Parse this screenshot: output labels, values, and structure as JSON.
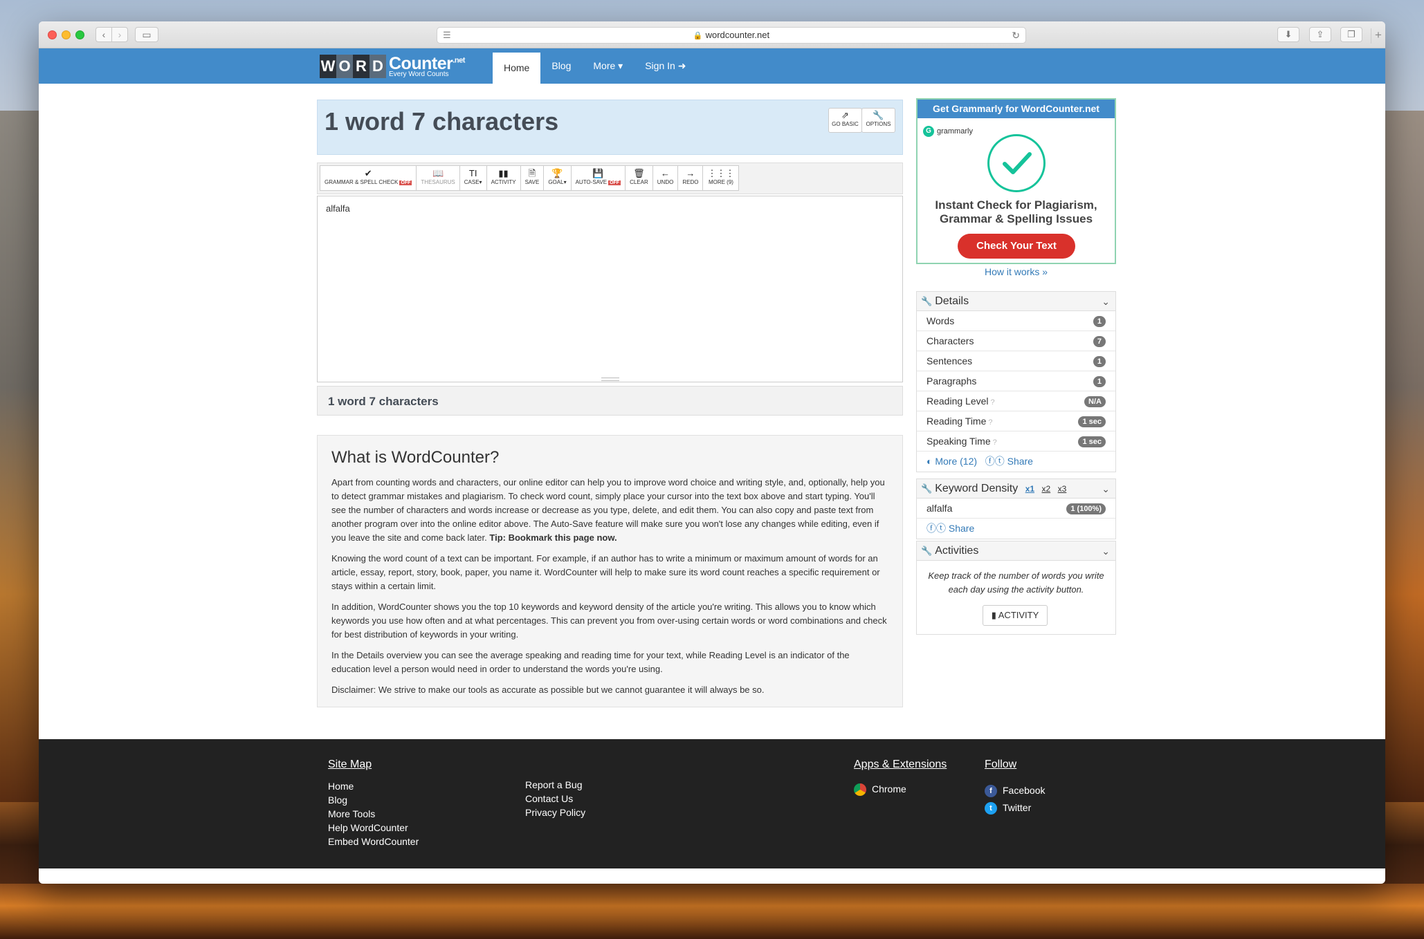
{
  "browser": {
    "url": "wordcounter.net"
  },
  "site": {
    "logo_letters": [
      "W",
      "O",
      "R",
      "D"
    ],
    "logo_name": "Counter",
    "logo_tld": ".net",
    "logo_tagline": "Every Word Counts",
    "nav": [
      "Home",
      "Blog",
      "More",
      "Sign In"
    ]
  },
  "counter": {
    "title": "1 word 7 characters",
    "go_basic": "GO BASIC",
    "options": "OPTIONS"
  },
  "toolbar": {
    "grammar": "GRAMMAR & SPELL CHECK",
    "off": "OFF",
    "thesaurus": "THESAURUS",
    "case": "CASE",
    "activity": "ACTIVITY",
    "save": "SAVE",
    "goal": "GOAL",
    "autosave": "AUTO-SAVE",
    "clear": "CLEAR",
    "undo": "UNDO",
    "redo": "REDO",
    "more": "MORE (9)"
  },
  "editor": {
    "text": "alfalfa"
  },
  "bottom_count": "1 word 7 characters",
  "about": {
    "title": "What is WordCounter?",
    "p1": "Apart from counting words and characters, our online editor can help you to improve word choice and writing style, and, optionally, help you to detect grammar mistakes and plagiarism. To check word count, simply place your cursor into the text box above and start typing. You'll see the number of characters and words increase or decrease as you type, delete, and edit them. You can also copy and paste text from another program over into the online editor above. The Auto-Save feature will make sure you won't lose any changes while editing, even if you leave the site and come back later.",
    "p1_tip": "Tip: Bookmark this page now.",
    "p2": "Knowing the word count of a text can be important. For example, if an author has to write a minimum or maximum amount of words for an article, essay, report, story, book, paper, you name it. WordCounter will help to make sure its word count reaches a specific requirement or stays within a certain limit.",
    "p3": "In addition, WordCounter shows you the top 10 keywords and keyword density of the article you're writing. This allows you to know which keywords you use how often and at what percentages. This can prevent you from over-using certain words or word combinations and check for best distribution of keywords in your writing.",
    "p4": "In the Details overview you can see the average speaking and reading time for your text, while Reading Level is an indicator of the education level a person would need in order to understand the words you're using.",
    "p5": "Disclaimer: We strive to make our tools as accurate as possible but we cannot guarantee it will always be so."
  },
  "grammarly": {
    "header": "Get Grammarly for WordCounter.net",
    "brand": "grammarly",
    "headline": "Instant Check for Plagiarism, Grammar & Spelling Issues",
    "cta": "Check Your Text",
    "how": "How it works »"
  },
  "details": {
    "title": "Details",
    "rows": [
      {
        "label": "Words",
        "value": "1"
      },
      {
        "label": "Characters",
        "value": "7"
      },
      {
        "label": "Sentences",
        "value": "1"
      },
      {
        "label": "Paragraphs",
        "value": "1"
      },
      {
        "label": "Reading Level",
        "value": "N/A"
      },
      {
        "label": "Reading Time",
        "value": "1 sec"
      },
      {
        "label": "Speaking Time",
        "value": "1 sec"
      }
    ],
    "more": "More (12)",
    "share": "Share"
  },
  "keyword_density": {
    "title": "Keyword Density",
    "x1": "x1",
    "x2": "x2",
    "x3": "x3",
    "rows": [
      {
        "keyword": "alfalfa",
        "value": "1 (100%)"
      }
    ],
    "share": "Share"
  },
  "activities": {
    "title": "Activities",
    "text": "Keep track of the number of words you write each day using the activity button.",
    "button": "ACTIVITY"
  },
  "footer": {
    "sitemap_title": "Site Map",
    "sitemap": [
      "Home",
      "Blog",
      "More Tools",
      "Help WordCounter",
      "Embed WordCounter"
    ],
    "misc": [
      "Report a Bug",
      "Contact Us",
      "Privacy Policy"
    ],
    "apps_title": "Apps & Extensions",
    "apps": [
      "Chrome"
    ],
    "follow_title": "Follow",
    "follow": [
      "Facebook",
      "Twitter"
    ]
  },
  "colors": {
    "navbar": "#428bca",
    "link": "#337ab7",
    "grammarly_green": "#15c39a",
    "cta_red": "#d9312b",
    "footer": "#222222"
  }
}
